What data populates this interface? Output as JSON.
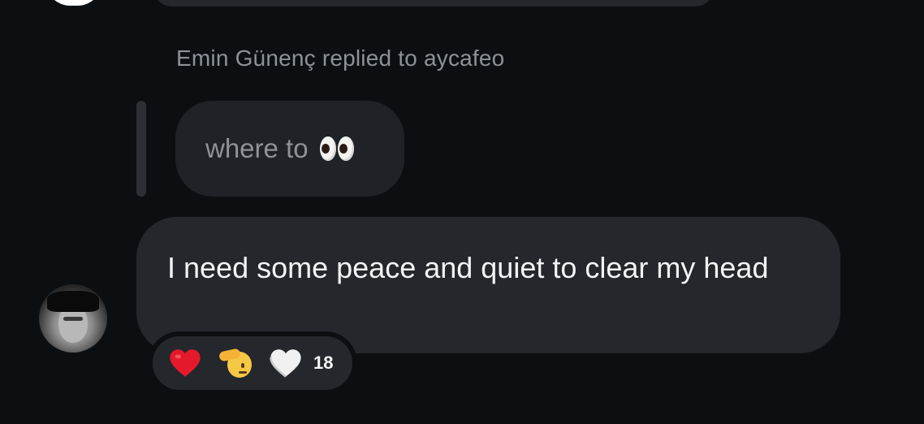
{
  "previous_message": {},
  "reply": {
    "header": "Emin Günenç replied to aycafeo",
    "quoted_text": "where to",
    "quoted_emoji": "eyes-icon"
  },
  "message": {
    "text": "I need some peace and quiet to clear my head"
  },
  "reactions": {
    "icons": [
      "red-heart-icon",
      "saluting-face-icon",
      "white-heart-icon"
    ],
    "count": "18"
  },
  "colors": {
    "background": "#0c0f12",
    "bubble": "#24272b",
    "quoted_bubble": "#1f2226",
    "muted_text": "#8d9298",
    "text": "#f3f4f5",
    "heart_red": "#e5192c"
  }
}
